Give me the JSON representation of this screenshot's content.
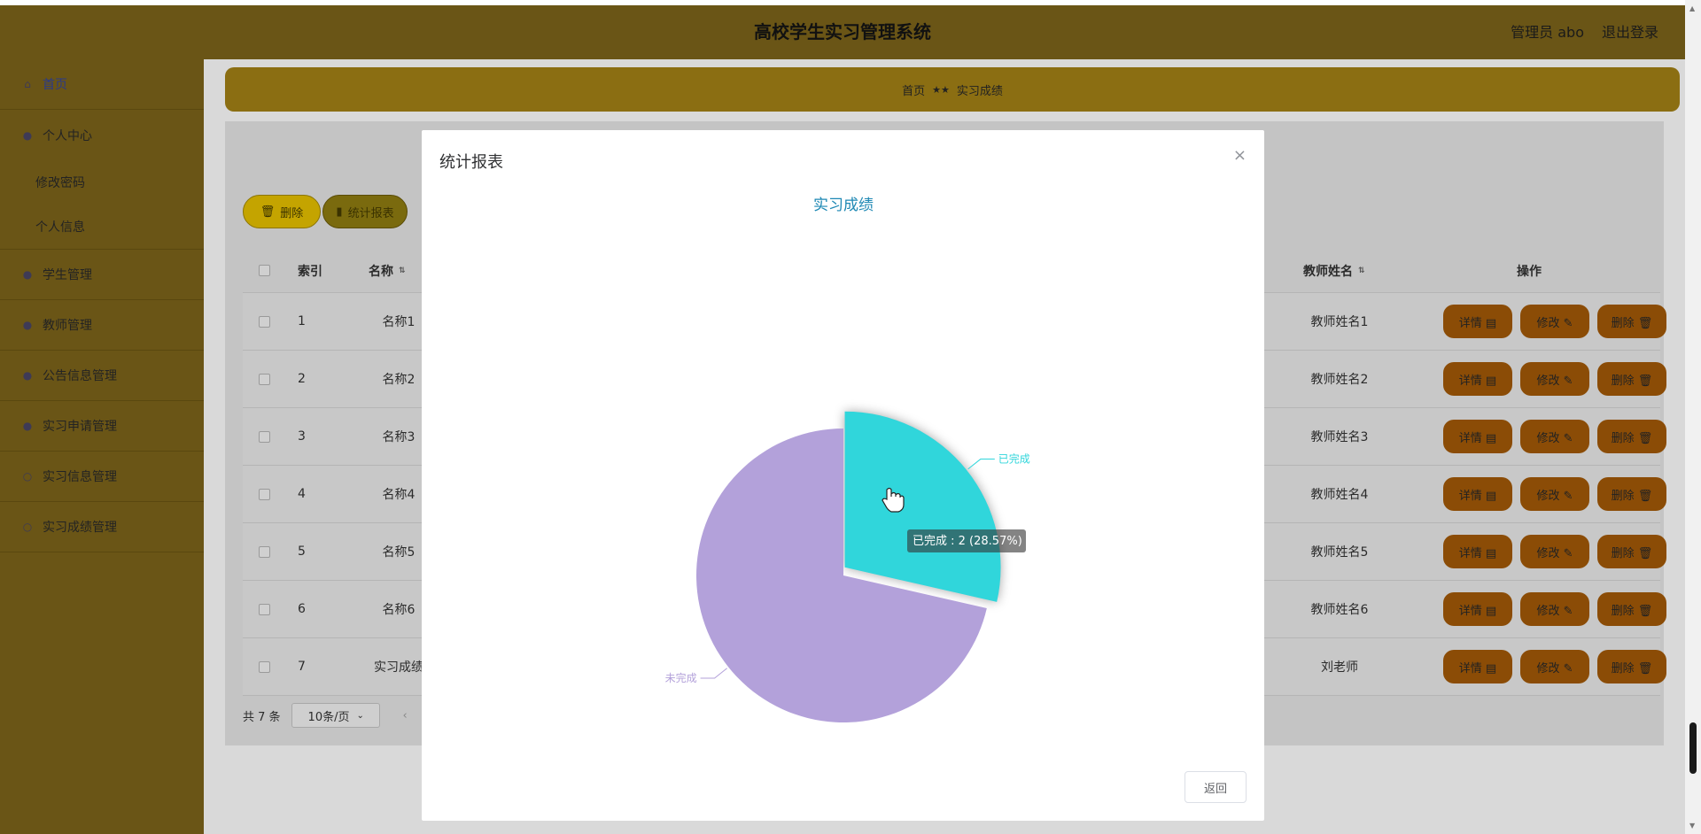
{
  "header": {
    "title": "高校学生实习管理系统",
    "admin_label": "管理员 abo",
    "logout_label": "退出登录"
  },
  "sidebar": {
    "items": [
      {
        "label": "首页",
        "icon": "home-icon"
      },
      {
        "label": "个人中心",
        "icon": "user-icon",
        "children": [
          "修改密码",
          "个人信息"
        ]
      },
      {
        "label": "学生管理",
        "icon": "student-icon"
      },
      {
        "label": "教师管理",
        "icon": "teacher-icon"
      },
      {
        "label": "公告信息管理",
        "icon": "notice-icon"
      },
      {
        "label": "实习申请管理",
        "icon": "apply-icon"
      },
      {
        "label": "实习信息管理",
        "icon": "info-icon"
      },
      {
        "label": "实习成绩管理",
        "icon": "score-icon"
      }
    ]
  },
  "breadcrumb": {
    "home": "首页",
    "sep": "★★",
    "current": "实习成绩"
  },
  "toolbar": {
    "delete_label": "删除",
    "stats_label": "统计报表"
  },
  "table": {
    "headers": {
      "index": "索引",
      "name": "名称",
      "teacher": "教师姓名",
      "actions": "操作"
    },
    "rows": [
      {
        "index": "1",
        "name": "名称1",
        "teacher": "教师姓名1"
      },
      {
        "index": "2",
        "name": "名称2",
        "teacher": "教师姓名2"
      },
      {
        "index": "3",
        "name": "名称3",
        "teacher": "教师姓名3"
      },
      {
        "index": "4",
        "name": "名称4",
        "teacher": "教师姓名4"
      },
      {
        "index": "5",
        "name": "名称5",
        "teacher": "教师姓名5"
      },
      {
        "index": "6",
        "name": "名称6",
        "teacher": "教师姓名6"
      },
      {
        "index": "7",
        "name": "实习成绩",
        "teacher": "刘老师"
      }
    ],
    "actions": {
      "detail": "详情 ▤",
      "edit": "修改 ✎",
      "delete": "删除 🗑"
    }
  },
  "pager": {
    "total": "共 7 条",
    "page_size": "10条/页"
  },
  "modal": {
    "title": "统计报表",
    "close": "×",
    "return_label": "返回"
  },
  "chart_data": {
    "type": "pie",
    "title": "实习成绩",
    "slices": [
      {
        "name": "已完成",
        "value": 2,
        "color": "#30d6db"
      },
      {
        "name": "未完成",
        "value": 5,
        "color": "#b3a1da"
      }
    ],
    "tooltip": "已完成 : 2 (28.57%)",
    "highlighted": "已完成"
  },
  "colors": {
    "header": "#6a5516",
    "accent": "#1e88b4"
  }
}
